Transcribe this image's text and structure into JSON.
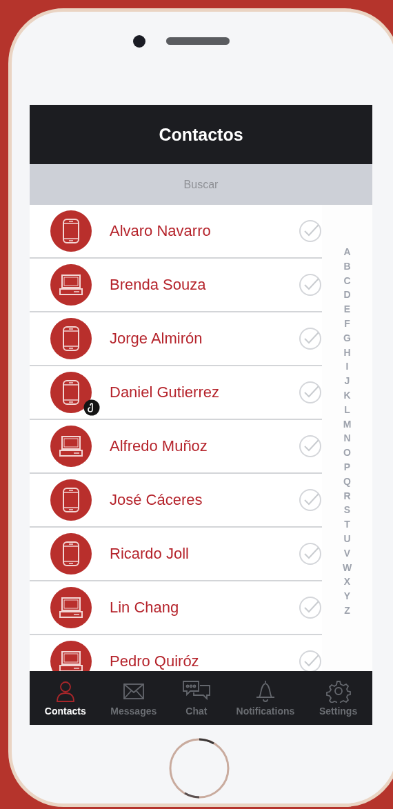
{
  "header": {
    "title": "Contactos"
  },
  "search": {
    "placeholder": "Buscar"
  },
  "contacts": [
    {
      "name": "Alvaro Navarro",
      "kind": "phone",
      "badge": false,
      "checked": false
    },
    {
      "name": "Brenda Souza",
      "kind": "laptop",
      "badge": false,
      "checked": false
    },
    {
      "name": "Jorge Almirón",
      "kind": "phone",
      "badge": false,
      "checked": false
    },
    {
      "name": "Daniel Gutierrez",
      "kind": "phone",
      "badge": true,
      "checked": false
    },
    {
      "name": "Alfredo Muñoz",
      "kind": "laptop",
      "badge": false,
      "checked": false
    },
    {
      "name": "José Cáceres",
      "kind": "phone",
      "badge": false,
      "checked": false
    },
    {
      "name": "Ricardo Joll",
      "kind": "phone",
      "badge": false,
      "checked": false
    },
    {
      "name": "Lin Chang",
      "kind": "laptop",
      "badge": false,
      "checked": false
    },
    {
      "name": "Pedro Quiróz",
      "kind": "laptop",
      "badge": false,
      "checked": false
    }
  ],
  "index": [
    "A",
    "B",
    "C",
    "D",
    "E",
    "F",
    "G",
    "H",
    "I",
    "J",
    "K",
    "L",
    "M",
    "N",
    "O",
    "P",
    "Q",
    "R",
    "S",
    "T",
    "U",
    "V",
    "W",
    "X",
    "Y",
    "Z"
  ],
  "tabs": [
    {
      "label": "Contacts",
      "kind": "contacts",
      "selected": true
    },
    {
      "label": "Messages",
      "kind": "messages",
      "selected": false
    },
    {
      "label": "Chat",
      "kind": "chat",
      "selected": false
    },
    {
      "label": "Notifications",
      "kind": "notifications",
      "selected": false
    },
    {
      "label": "Settings",
      "kind": "settings",
      "selected": false
    }
  ]
}
